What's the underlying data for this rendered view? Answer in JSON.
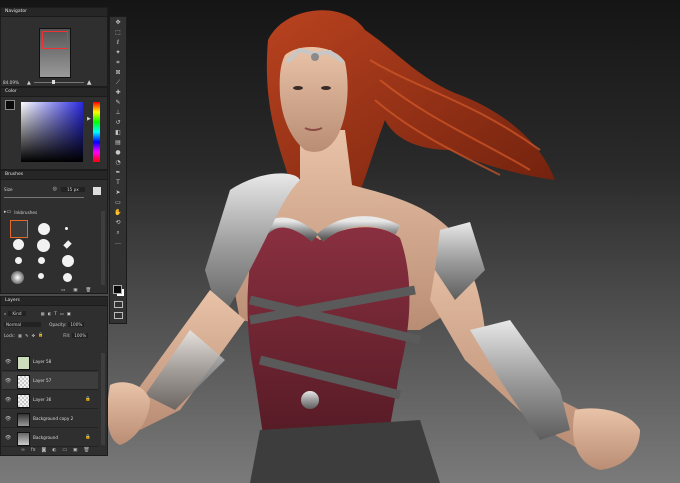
{
  "navigator": {
    "title": "Navigator",
    "zoom": "84.09%"
  },
  "color": {
    "title": "Color",
    "foreground": "#0a0a0a",
    "background": "#ffffff",
    "hue": "#2a2ae0"
  },
  "brushes": {
    "title": "Brushes",
    "size_label": "Size",
    "size_value": "15 px",
    "folder": "Inkbrushes"
  },
  "layers": {
    "title": "Layers",
    "filter_label": "Kind",
    "blend_mode": "Normal",
    "opacity_label": "Opacity:",
    "opacity_value": "100%",
    "lock_label": "Lock:",
    "fill_label": "Fill:",
    "fill_value": "100%",
    "items": [
      {
        "name": "Layer 58",
        "locked": false
      },
      {
        "name": "Layer 57",
        "locked": false
      },
      {
        "name": "Layer 36",
        "locked": true
      },
      {
        "name": "Background copy 2",
        "locked": false
      },
      {
        "name": "Background",
        "locked": true
      }
    ],
    "footer_icons": [
      "link-icon",
      "fx-icon",
      "mask-icon",
      "adjustment-icon",
      "folder-icon",
      "new-layer-icon",
      "trash-icon"
    ]
  },
  "toolbar": {
    "tools": [
      "move-icon",
      "marquee-icon",
      "lasso-icon",
      "magic-wand-icon",
      "crop-icon",
      "frame-icon",
      "eyedropper-icon",
      "healing-icon",
      "brush-icon",
      "stamp-icon",
      "history-brush-icon",
      "eraser-icon",
      "gradient-icon",
      "blur-icon",
      "dodge-icon",
      "pen-icon",
      "type-icon",
      "path-select-icon",
      "rectangle-icon",
      "hand-icon",
      "rotate-icon",
      "zoom-icon",
      "more-icon",
      "colors-icon",
      "quickmask-icon",
      "screenmode-icon"
    ]
  }
}
